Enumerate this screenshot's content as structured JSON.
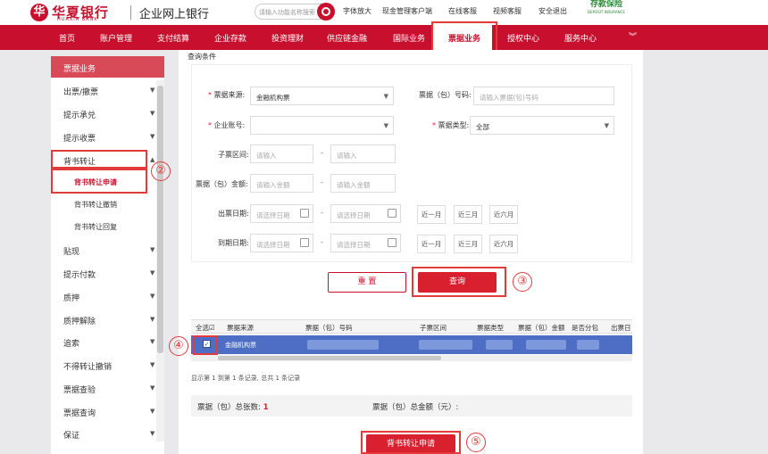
{
  "header": {
    "logo_mark": "华",
    "logo_cn": "华夏银行",
    "logo_en": "HUAXIA BANK",
    "system_title": "企业网上银行",
    "search_placeholder": "请输入功能名称搜索",
    "links": [
      "字体放大",
      "现金管理客户端",
      "在线客服",
      "视频客服",
      "安全退出"
    ],
    "brand2_top": "存款保险",
    "brand2_sub": "DEPOSIT INSURANCE",
    "accent_color": "#c8102e"
  },
  "nav": {
    "items": [
      "首页",
      "账户管理",
      "支付结算",
      "企业存款",
      "投资理财",
      "供应链金融",
      "国际业务",
      "票据业务",
      "授权中心",
      "服务中心"
    ],
    "active": "票据业务",
    "more_icon": "chevron-down-icon"
  },
  "sidebar": {
    "header": "票据业务",
    "items": [
      "出票/撤票",
      "提示承兑",
      "提示收票",
      "背书转让",
      "贴现",
      "提示付款",
      "质押",
      "质押解除",
      "追索",
      "不得转让撤销",
      "票据查验",
      "票据查询",
      "保证"
    ],
    "subitems": [
      "背书转让申请",
      "背书转让撤销",
      "背书转让回复"
    ],
    "active_sub": "背书转让申请"
  },
  "form": {
    "section_title": "查询条件",
    "source_label": "票据来源:",
    "source_value": "金融机构票",
    "number_label": "票据（包）号码:",
    "number_placeholder": "请输入票据(包)号码",
    "account_label": "企业账号:",
    "type_label": "票据类型:",
    "type_value": "全部",
    "range_label": "子票区间:",
    "amount_label": "票据（包）金额:",
    "issue_label": "出票日期:",
    "due_label": "到期日期:",
    "input_placeholder": "请输入",
    "amount_placeholder": "请输入金额",
    "date_placeholder": "请选择日期",
    "quick_ranges": [
      "近一月",
      "近三月",
      "近六月"
    ],
    "reset_label": "重 置",
    "query_label": "查询"
  },
  "table": {
    "columns": [
      "全选",
      "票据来源",
      "票据（包）号码",
      "子票区间",
      "票据类型",
      "票据（包）金额",
      "是否分包",
      "出票日"
    ],
    "rows": [
      {
        "source": "金融机构票",
        "checked": "✓"
      }
    ],
    "info": "显示第 1 到第 1 条记录, 总共 1 条记录"
  },
  "summary": {
    "count_label": "票据（包）总张数:",
    "count_value": "1",
    "amount_label": "票据（包）总金额（元）:"
  },
  "submit_label": "背书转让申请",
  "annotations": [
    "①",
    "②",
    "③",
    "④",
    "⑤"
  ]
}
